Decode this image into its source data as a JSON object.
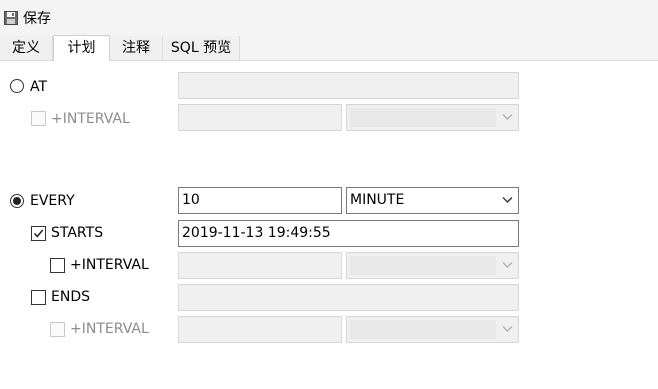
{
  "toolbar": {
    "save_label": "保存",
    "save_icon": "floppy-disk-icon"
  },
  "tabs": [
    {
      "label": "定义",
      "active": false
    },
    {
      "label": "计划",
      "active": true
    },
    {
      "label": "注释",
      "active": false
    },
    {
      "label": "SQL 预览",
      "active": false
    }
  ],
  "schedule": {
    "at": {
      "label": "AT",
      "selected": false,
      "value": ""
    },
    "at_interval": {
      "label": "+INTERVAL",
      "checked": false,
      "enabled": false,
      "value": "",
      "unit": ""
    },
    "every": {
      "label": "EVERY",
      "selected": true,
      "value": "10",
      "unit": "MINUTE"
    },
    "starts": {
      "label": "STARTS",
      "checked": true,
      "value": "2019-11-13 19:49:55"
    },
    "starts_interval": {
      "label": "+INTERVAL",
      "checked": false,
      "enabled": true,
      "value": "",
      "unit": ""
    },
    "ends": {
      "label": "ENDS",
      "checked": false,
      "value": ""
    },
    "ends_interval": {
      "label": "+INTERVAL",
      "checked": false,
      "enabled": false,
      "value": "",
      "unit": ""
    }
  }
}
